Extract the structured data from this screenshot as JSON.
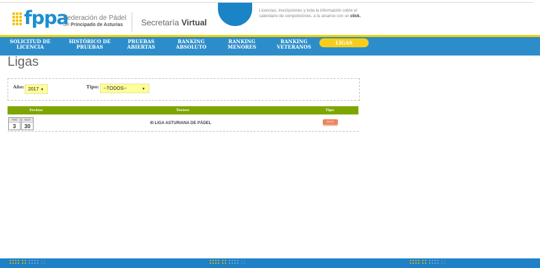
{
  "header": {
    "logo_text": "fppa",
    "federation_line1": "Federación de Pádel",
    "federation_line2_prefix": "del ",
    "federation_line2_bold": "Principado de Asturias",
    "secretaria_prefix": "Secretaría ",
    "secretaria_bold": "Virtual",
    "info_text": "Licencias, inscripciones y toda la información sobre el calendario de competiciones, a tu alcance con un ",
    "info_bold": "click."
  },
  "nav": {
    "items": [
      {
        "line1": "SOLICITUD DE",
        "line2": "LICENCIA"
      },
      {
        "line1": "HISTÓRICO DE",
        "line2": "PRUEBAS"
      },
      {
        "line1": "PRUEBAS",
        "line2": "ABIERTAS"
      },
      {
        "line1": "RANKING",
        "line2": "ABSOLUTO"
      },
      {
        "line1": "RANKING",
        "line2": "MENORES"
      },
      {
        "line1": "RANKING",
        "line2": "VETERANOS"
      },
      {
        "line1": "LIGAS",
        "line2": ""
      }
    ],
    "active": "LIGAS"
  },
  "page": {
    "title": "Ligas"
  },
  "filters": {
    "year_label": "Año:",
    "year_value": "2017",
    "type_label": "Tipo:",
    "type_value": "--TODOS--"
  },
  "table": {
    "headers": [
      "Fechas",
      "Torneo",
      "Tipo"
    ],
    "rows": [
      {
        "start_month": "FEB",
        "start_day": "3",
        "end_month": "NOV",
        "end_day": "30",
        "torneo": "III LIGA ASTURIANA DE PÁDEL",
        "tipo": "FEYS"
      }
    ]
  },
  "colors": {
    "brand_blue": "#2d8dca",
    "accent_yellow": "#f6cd1b",
    "table_header_green": "#7da600",
    "badge_orange": "#ef845b"
  }
}
